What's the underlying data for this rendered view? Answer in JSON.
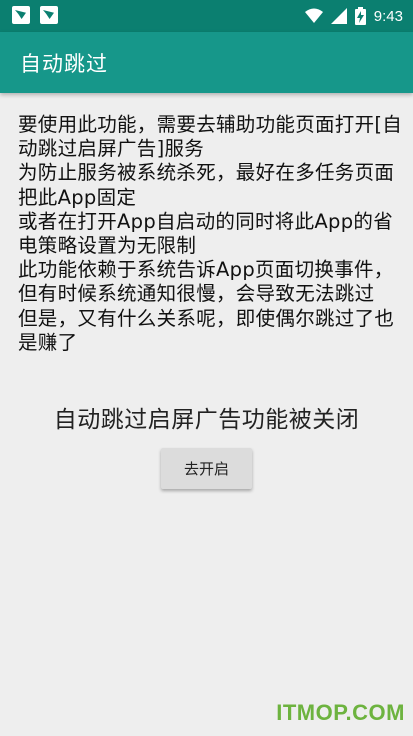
{
  "status_bar": {
    "time": "9:43",
    "notification_icons": [
      "app-notification-icon",
      "app-notification-icon"
    ],
    "system_icons": [
      "wifi-icon",
      "signal-icon",
      "battery-charging-icon"
    ]
  },
  "app_bar": {
    "title": "自动跳过"
  },
  "description": "要使用此功能，需要去辅助功能页面打开[自动跳过启屏广告]服务\n为防止服务被系统杀死，最好在多任务页面把此App固定\n或者在打开App自启动的同时将此App的省电策略设置为无限制\n此功能依赖于系统告诉App页面切换事件，但有时候系统通知很慢，会导致无法跳过\n但是，又有什么关系呢，即使偶尔跳过了也是赚了",
  "status_message": "自动跳过启屏广告功能被关闭",
  "enable_button": {
    "label": "去开启"
  },
  "watermark": "ITMOP.COM",
  "colors": {
    "status_bar": "#0b7f70",
    "app_bar": "#16978a",
    "background": "#eeeeee",
    "watermark": "#6db33f"
  }
}
